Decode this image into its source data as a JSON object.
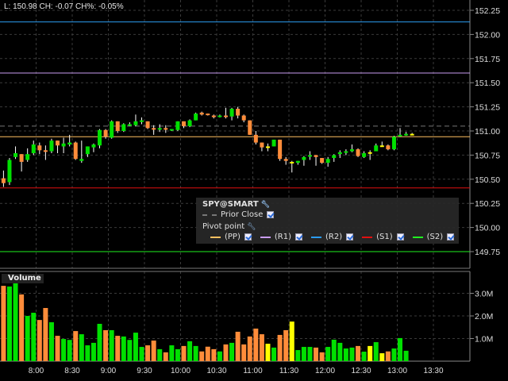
{
  "header": {
    "text": "L: 150.98 CH: -0.07 CH%: -0.05%"
  },
  "colors": {
    "up": "#00e000",
    "down": "#ff8c3a",
    "neutral": "#ffff00",
    "pp": "#ffc060",
    "r1": "#c89cf0",
    "r2": "#2b9cf0",
    "s1": "#e01010",
    "s2": "#20f020",
    "prior_close": "#777777"
  },
  "price_axis": {
    "min": 149.5,
    "max": 152.4,
    "ticks": [
      "152.25",
      "152.00",
      "151.75",
      "151.50",
      "151.25",
      "151.00",
      "150.75",
      "150.50",
      "150.25",
      "150.00",
      "149.75"
    ]
  },
  "levels": {
    "r2": 152.13,
    "r1": 151.6,
    "prior_close": 151.05,
    "pp": 150.94,
    "s1": 150.41,
    "s2": 149.75
  },
  "volume_axis": {
    "ticks": [
      "3.0M",
      "2.0M",
      "1.0M"
    ],
    "tick_values": [
      3,
      2,
      1
    ]
  },
  "time_axis": {
    "labels": [
      "8:00",
      "8:30",
      "9:00",
      "9:30",
      "10:00",
      "10:30",
      "11:00",
      "11:30",
      "12:00",
      "12:30",
      "13:00",
      "13:30"
    ]
  },
  "legend": {
    "symbol": "SPY@SMART",
    "prior_close": "Prior Close",
    "pivot": "Pivot point",
    "items": [
      {
        "key": "pp",
        "label": "(PP)"
      },
      {
        "key": "r1",
        "label": "(R1)"
      },
      {
        "key": "r2",
        "label": "(R2)"
      },
      {
        "key": "s1",
        "label": "(S1)"
      },
      {
        "key": "s2",
        "label": "(S2)"
      }
    ]
  },
  "volume_label": "Volume",
  "candles": [
    [
      150.51,
      150.46,
      150.59,
      150.42,
      "d"
    ],
    [
      150.47,
      150.7,
      150.72,
      150.44,
      "u"
    ],
    [
      150.73,
      150.77,
      150.84,
      150.71,
      "u"
    ],
    [
      150.76,
      150.68,
      150.76,
      150.58,
      "d"
    ],
    [
      150.7,
      150.76,
      150.82,
      150.68,
      "u"
    ],
    [
      150.77,
      150.86,
      150.9,
      150.75,
      "u"
    ],
    [
      150.85,
      150.8,
      150.88,
      150.76,
      "d"
    ],
    [
      150.8,
      150.79,
      150.85,
      150.7,
      "d"
    ],
    [
      150.79,
      150.9,
      150.92,
      150.77,
      "u"
    ],
    [
      150.9,
      150.85,
      150.9,
      150.77,
      "d"
    ],
    [
      150.84,
      150.87,
      150.93,
      150.77,
      "u"
    ],
    [
      150.86,
      150.88,
      150.96,
      150.84,
      "u"
    ],
    [
      150.88,
      150.71,
      150.89,
      150.7,
      "d"
    ],
    [
      150.69,
      150.71,
      150.9,
      150.67,
      "u"
    ],
    [
      150.76,
      150.84,
      150.84,
      150.73,
      "u"
    ],
    [
      150.83,
      150.86,
      150.87,
      150.78,
      "u"
    ],
    [
      150.85,
      151.01,
      151.02,
      150.82,
      "u"
    ],
    [
      151.01,
      150.94,
      151.02,
      150.92,
      "d"
    ],
    [
      150.93,
      151.1,
      151.11,
      150.92,
      "u"
    ],
    [
      151.1,
      151.0,
      151.1,
      150.98,
      "d"
    ],
    [
      151.0,
      151.07,
      151.08,
      150.99,
      "u"
    ],
    [
      151.06,
      151.07,
      151.09,
      151.05,
      "u"
    ],
    [
      151.06,
      151.1,
      151.17,
      151.05,
      "u"
    ],
    [
      151.1,
      151.11,
      151.14,
      151.07,
      "u"
    ],
    [
      151.1,
      151.03,
      151.1,
      151.02,
      "d"
    ],
    [
      151.03,
      151.02,
      151.06,
      150.96,
      "d"
    ],
    [
      151.02,
      151.03,
      151.07,
      150.99,
      "u"
    ],
    [
      151.03,
      151.02,
      151.06,
      150.98,
      "d"
    ],
    [
      151.01,
      151.02,
      151.02,
      151.0,
      "u"
    ],
    [
      151.01,
      151.1,
      151.1,
      151.0,
      "u"
    ],
    [
      151.1,
      151.05,
      151.1,
      151.03,
      "d"
    ],
    [
      151.05,
      151.11,
      151.12,
      151.04,
      "u"
    ],
    [
      151.11,
      151.18,
      151.19,
      151.11,
      "u"
    ],
    [
      151.19,
      151.17,
      151.2,
      151.16,
      "d"
    ],
    [
      151.18,
      151.17,
      151.18,
      151.16,
      "d"
    ],
    [
      151.16,
      151.15,
      151.17,
      151.13,
      "d"
    ],
    [
      151.15,
      151.16,
      151.17,
      151.14,
      "u"
    ],
    [
      151.16,
      151.15,
      151.24,
      151.13,
      "d"
    ],
    [
      151.15,
      151.23,
      151.24,
      151.11,
      "u"
    ],
    [
      151.23,
      151.16,
      151.25,
      151.13,
      "d"
    ],
    [
      151.16,
      151.11,
      151.17,
      151.09,
      "d"
    ],
    [
      151.11,
      150.96,
      151.11,
      150.96,
      "d"
    ],
    [
      150.96,
      150.88,
      151.0,
      150.86,
      "d"
    ],
    [
      150.88,
      150.83,
      150.88,
      150.79,
      "d"
    ],
    [
      150.84,
      150.83,
      150.87,
      150.79,
      "n"
    ],
    [
      150.84,
      150.91,
      150.91,
      150.84,
      "u"
    ],
    [
      150.91,
      150.71,
      150.91,
      150.69,
      "d"
    ],
    [
      150.71,
      150.69,
      150.73,
      150.65,
      "d"
    ],
    [
      150.68,
      150.67,
      150.69,
      150.57,
      "n"
    ],
    [
      150.67,
      150.69,
      150.69,
      150.65,
      "u"
    ],
    [
      150.7,
      150.73,
      150.74,
      150.64,
      "u"
    ],
    [
      150.74,
      150.75,
      150.79,
      150.7,
      "u"
    ],
    [
      150.75,
      150.73,
      150.75,
      150.64,
      "d"
    ],
    [
      150.72,
      150.67,
      150.72,
      150.66,
      "d"
    ],
    [
      150.67,
      150.71,
      150.73,
      150.63,
      "u"
    ],
    [
      150.72,
      150.75,
      150.76,
      150.68,
      "u"
    ],
    [
      150.76,
      150.78,
      150.8,
      150.72,
      "u"
    ],
    [
      150.78,
      150.79,
      150.81,
      150.75,
      "u"
    ],
    [
      150.79,
      150.81,
      150.86,
      150.78,
      "u"
    ],
    [
      150.81,
      150.74,
      150.82,
      150.73,
      "d"
    ],
    [
      150.73,
      150.77,
      150.79,
      150.72,
      "u"
    ],
    [
      150.78,
      150.77,
      150.8,
      150.7,
      "n"
    ],
    [
      150.79,
      150.85,
      150.87,
      150.79,
      "u"
    ],
    [
      150.85,
      150.84,
      150.89,
      150.84,
      "n"
    ],
    [
      150.85,
      150.81,
      150.86,
      150.8,
      "d"
    ],
    [
      150.81,
      150.94,
      150.95,
      150.8,
      "u"
    ],
    [
      150.95,
      150.96,
      151.03,
      150.94,
      "u"
    ],
    [
      150.96,
      150.97,
      150.99,
      150.95,
      "u"
    ],
    [
      150.97,
      150.96,
      150.98,
      150.96,
      "n"
    ]
  ],
  "volumes": [
    3.33,
    3.3,
    3.74,
    2.95,
    2.0,
    2.14,
    1.82,
    2.35,
    1.72,
    1.12,
    0.98,
    0.94,
    1.33,
    1.19,
    0.7,
    0.81,
    1.65,
    1.37,
    1.37,
    1.12,
    1.09,
    0.94,
    1.26,
    0.63,
    0.7,
    0.91,
    0.53,
    0.39,
    0.7,
    0.53,
    0.67,
    0.88,
    0.67,
    0.43,
    0.64,
    0.53,
    0.43,
    0.74,
    0.81,
    1.3,
    0.74,
    1.09,
    1.44,
    1.19,
    0.77,
    0.6,
    1.16,
    1.37,
    1.75,
    0.49,
    0.63,
    0.63,
    0.6,
    0.39,
    0.63,
    0.95,
    0.81,
    0.56,
    0.6,
    0.67,
    0.42,
    0.67,
    0.84,
    0.35,
    0.43,
    0.56,
    1.02,
    0.46
  ]
}
